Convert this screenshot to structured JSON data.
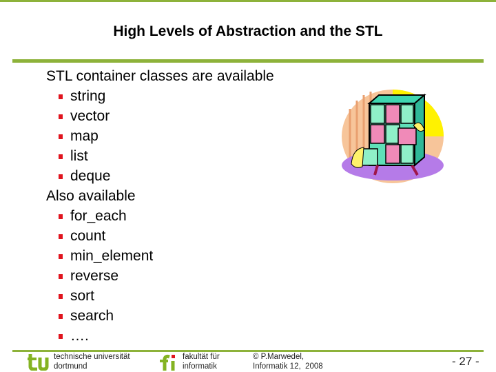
{
  "slide": {
    "title": "High Levels of Abstraction and the STL",
    "sections": [
      {
        "heading": "STL container classes are available",
        "items": [
          "string",
          "vector",
          "map",
          "list",
          "deque"
        ]
      },
      {
        "heading": "Also available",
        "items": [
          "for_each",
          "count",
          "min_element",
          "reverse",
          "sort",
          "search",
          "…."
        ]
      }
    ],
    "clipart": "filing-cabinet-clipart"
  },
  "footer": {
    "university_line1": "technische universität",
    "university_line2": "dortmund",
    "faculty_line1": "fakultät für",
    "faculty_line2": "informatik",
    "copyright_line1": "© P.Marwedel,",
    "copyright_line2": "Informatik 12,  2008",
    "page_number": "- 27 -"
  },
  "colors": {
    "accent_green": "#8db23a",
    "bullet_red": "#e0141e"
  }
}
